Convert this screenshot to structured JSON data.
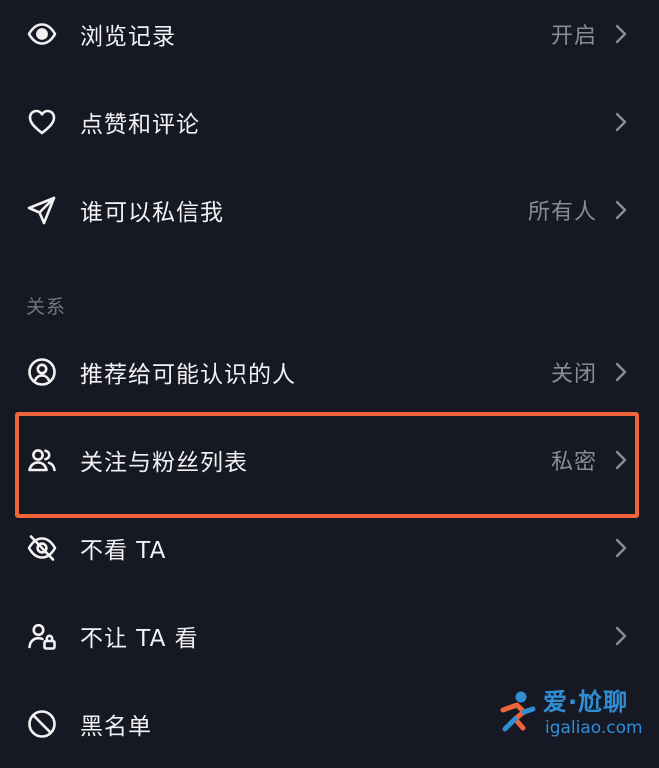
{
  "rows_top": [
    {
      "label": "浏览记录",
      "value": "开启",
      "icon": "eye-icon"
    },
    {
      "label": "点赞和评论",
      "value": "",
      "icon": "heart-icon"
    },
    {
      "label": "谁可以私信我",
      "value": "所有人",
      "icon": "paper-plane-icon"
    }
  ],
  "section": {
    "title": "关系"
  },
  "rows_relation": [
    {
      "label": "推荐给可能认识的人",
      "value": "关闭",
      "icon": "user-circle-icon"
    },
    {
      "label": "关注与粉丝列表",
      "value": "私密",
      "icon": "users-icon"
    },
    {
      "label": "不看 TA",
      "value": "",
      "icon": "eye-off-icon"
    },
    {
      "label": "不让 TA 看",
      "value": "",
      "icon": "user-lock-icon"
    },
    {
      "label": "黑名单",
      "value": "",
      "icon": "block-icon"
    }
  ],
  "highlight": {
    "color": "#f0643a"
  },
  "watermark": {
    "title": "爱·尬聊",
    "url": "igaliao.com",
    "color": "#2f8fd6"
  },
  "colors": {
    "background": "#161823",
    "text": "#f2f2f3",
    "secondary": "#8b8c93"
  }
}
